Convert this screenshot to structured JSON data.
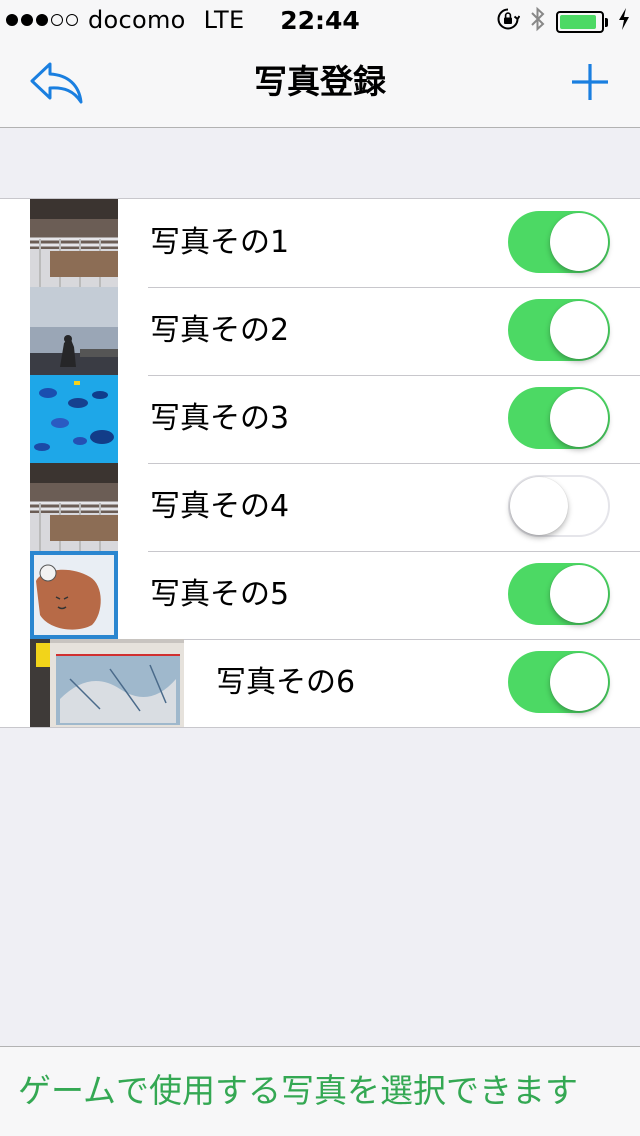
{
  "status_bar": {
    "signal_filled": 3,
    "signal_total": 5,
    "carrier": "docomo",
    "network": "LTE",
    "time": "22:44",
    "battery_level": 0.9
  },
  "nav": {
    "title": "写真登録",
    "back_icon": "reply-arrow-icon",
    "add_icon": "plus-icon"
  },
  "photos": [
    {
      "label": "写真その1",
      "enabled": true
    },
    {
      "label": "写真その2",
      "enabled": true
    },
    {
      "label": "写真その3",
      "enabled": true
    },
    {
      "label": "写真その4",
      "enabled": false
    },
    {
      "label": "写真その5",
      "enabled": true
    },
    {
      "label": "写真その6",
      "enabled": true
    }
  ],
  "footer": {
    "text": "ゲームで使用する写真を選択できます"
  },
  "colors": {
    "accent": "#1a7fe0",
    "toggle_on": "#4cd964",
    "footer_text": "#34a853"
  }
}
